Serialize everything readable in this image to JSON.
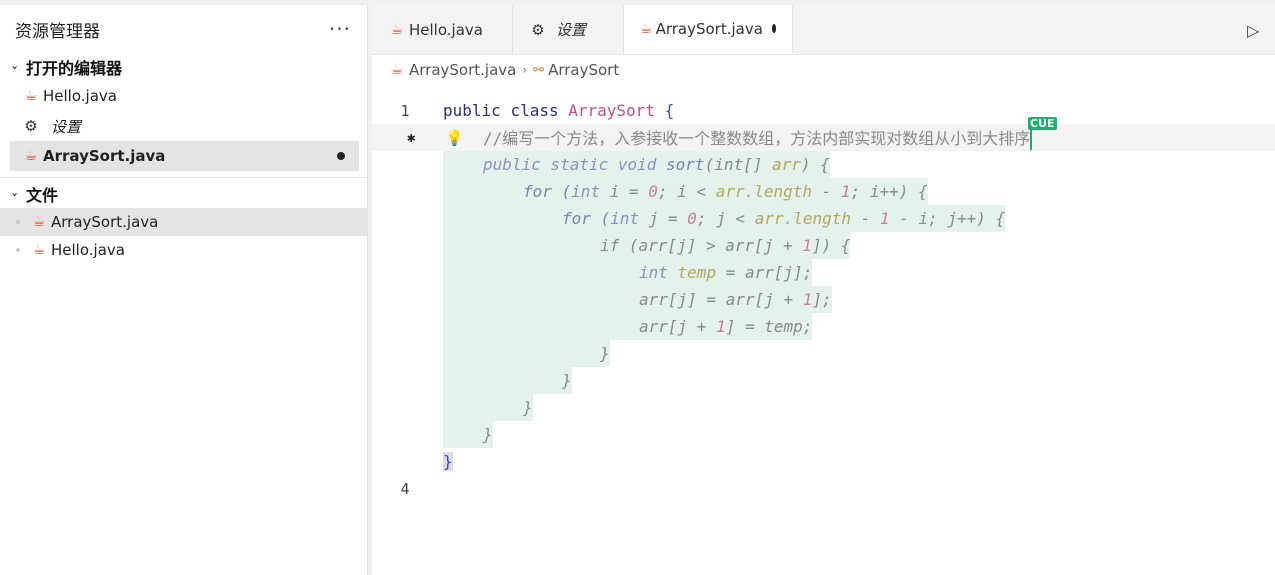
{
  "sidebar": {
    "title": "资源管理器",
    "more": "···",
    "open_editors": {
      "heading": "打开的编辑器",
      "items": [
        {
          "label": "Hello.java"
        },
        {
          "label": "设置"
        },
        {
          "label": "ArraySort.java"
        }
      ]
    },
    "files": {
      "heading": "文件",
      "items": [
        {
          "label": "ArraySort.java"
        },
        {
          "label": "Hello.java"
        }
      ]
    }
  },
  "tabs": [
    {
      "label": "Hello.java"
    },
    {
      "label": "设置"
    },
    {
      "label": "ArraySort.java"
    }
  ],
  "breadcrumb": {
    "file": "ArraySort.java",
    "symbol": "ArraySort"
  },
  "editor": {
    "line_numbers": {
      "first": "1",
      "last": "4"
    },
    "cue_badge": "CUE",
    "line1": {
      "kw1": "public",
      "kw2": "class",
      "cls": "ArraySort",
      "brace": "{"
    },
    "comment": "//编写一个方法，入参接收一个整数数组，方法内部实现对数组从小到大排序",
    "ghost": {
      "l3": {
        "a": "public static void ",
        "b": "sort",
        "c": "(int[] ",
        "d": "arr",
        "e": ") {"
      },
      "l4": {
        "a": "for (",
        "b": "int",
        "c": " i = ",
        "d": "0",
        "e": "; i < ",
        "f": "arr.length",
        "g": " - ",
        "h": "1",
        "i": "; i++) {"
      },
      "l5": {
        "a": "for (",
        "b": "int",
        "c": " j = ",
        "d": "0",
        "e": "; j < ",
        "f": "arr.length",
        "g": " - ",
        "h": "1",
        "i": " - i; j++) {"
      },
      "l6": {
        "a": "if (arr[j] > arr[j + ",
        "b": "1",
        "c": "]) {"
      },
      "l7": {
        "a": "int",
        "b": " temp",
        "c": " = arr[j];"
      },
      "l8": {
        "a": "arr[j] = arr[j + ",
        "b": "1",
        "c": "];"
      },
      "l9": {
        "a": "arr[j + ",
        "b": "1",
        "c": "] = temp;"
      },
      "close": "}"
    },
    "closing_brace": "}"
  },
  "colors": {
    "java_icon": "#e05d34",
    "ghost_bg": "#e3f2ea",
    "cue_badge": "#19b26b"
  }
}
